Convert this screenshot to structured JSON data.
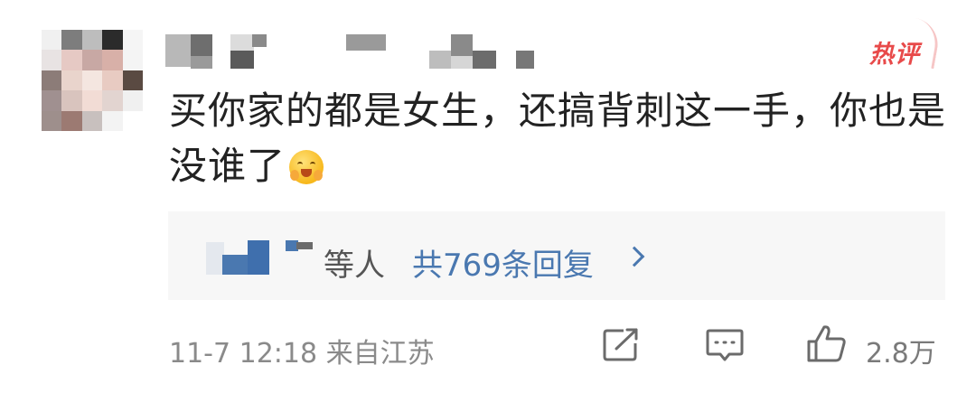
{
  "badge": {
    "label": "热评"
  },
  "comment": {
    "text": "买你家的都是女生，还搞背刺这一手，你也是没谁了",
    "emoji": "blush-hug-emoji"
  },
  "replies": {
    "etc_label": "等人",
    "count_label": "共769条回复"
  },
  "meta": {
    "time_location": "11-7 12:18 来自江苏"
  },
  "actions": {
    "like_count": "2.8万"
  },
  "colors": {
    "accent_link": "#4a78b0",
    "hot_badge": "#e84a4a",
    "meta_text": "#8a8a8a"
  }
}
